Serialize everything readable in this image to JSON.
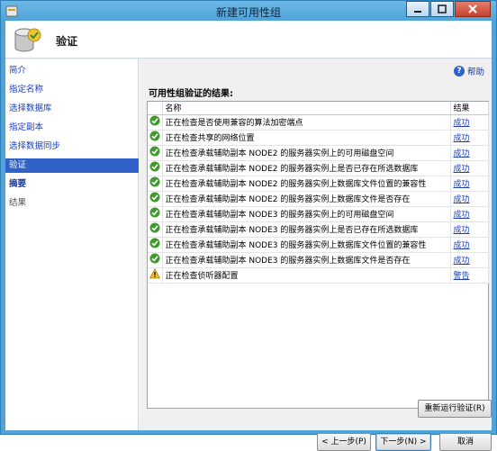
{
  "window": {
    "title": "新建可用性组"
  },
  "header": {
    "title": "验证"
  },
  "nav": {
    "items": [
      {
        "label": "简介",
        "state": "link"
      },
      {
        "label": "指定名称",
        "state": "link"
      },
      {
        "label": "选择数据库",
        "state": "link"
      },
      {
        "label": "指定副本",
        "state": "link"
      },
      {
        "label": "选择数据同步",
        "state": "link"
      },
      {
        "label": "验证",
        "state": "active"
      },
      {
        "label": "摘要",
        "state": "bold"
      },
      {
        "label": "结果",
        "state": "plain"
      }
    ]
  },
  "help": {
    "label": "帮助"
  },
  "main": {
    "section_title": "可用性组验证的结果:",
    "columns": [
      "名称",
      "结果"
    ],
    "rows": [
      {
        "status": "success",
        "name": "正在检查是否使用兼容的算法加密端点",
        "result": "成功"
      },
      {
        "status": "success",
        "name": "正在检查共享的网络位置",
        "result": "成功"
      },
      {
        "status": "success",
        "name": "正在检查承载辅助副本 NODE2 的服务器实例上的可用磁盘空间",
        "result": "成功"
      },
      {
        "status": "success",
        "name": "正在检查承载辅助副本 NODE2 的服务器实例上是否已存在所选数据库",
        "result": "成功"
      },
      {
        "status": "success",
        "name": "正在检查承载辅助副本 NODE2 的服务器实例上数据库文件位置的兼容性",
        "result": "成功"
      },
      {
        "status": "success",
        "name": "正在检查承载辅助副本 NODE2 的服务器实例上数据库文件是否存在",
        "result": "成功"
      },
      {
        "status": "success",
        "name": "正在检查承载辅助副本 NODE3 的服务器实例上的可用磁盘空间",
        "result": "成功"
      },
      {
        "status": "success",
        "name": "正在检查承载辅助副本 NODE3 的服务器实例上是否已存在所选数据库",
        "result": "成功"
      },
      {
        "status": "success",
        "name": "正在检查承载辅助副本 NODE3 的服务器实例上数据库文件位置的兼容性",
        "result": "成功"
      },
      {
        "status": "success",
        "name": "正在检查承载辅助副本 NODE3 的服务器实例上数据库文件是否存在",
        "result": "成功"
      },
      {
        "status": "warning",
        "name": "正在检查侦听器配置",
        "result": "警告"
      }
    ]
  },
  "buttons": {
    "rerun": "重新运行验证(R)",
    "prev": "< 上一步(P)",
    "next": "下一步(N) >",
    "cancel": "取消"
  }
}
